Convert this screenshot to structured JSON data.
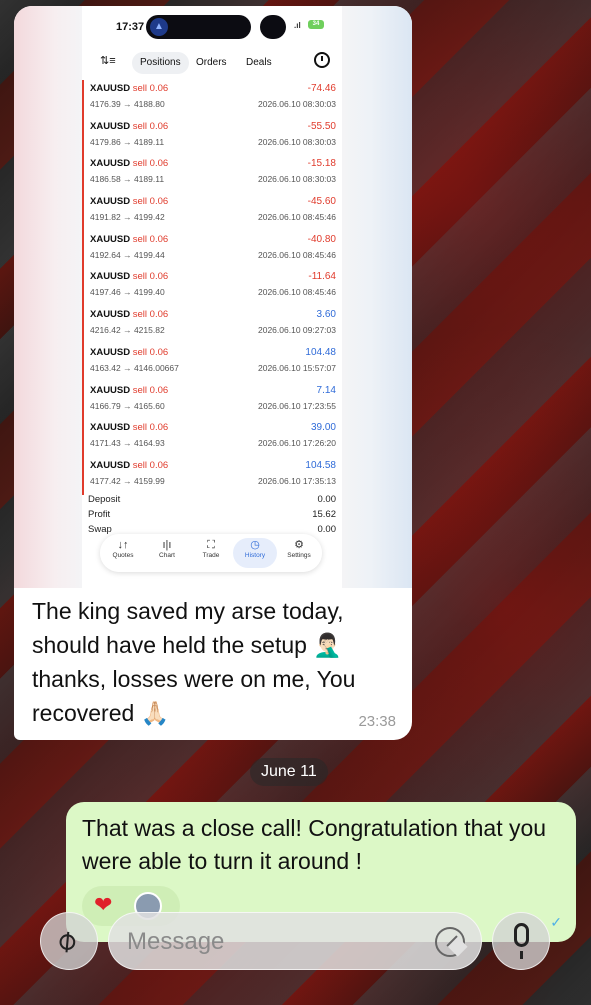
{
  "screenshot": {
    "status_time": "17:37",
    "nav_arrow": "navigation-arrow-icon",
    "battery": "34",
    "tabs": [
      {
        "label": "Positions",
        "active": true
      },
      {
        "label": "Orders",
        "active": false
      },
      {
        "label": "Deals",
        "active": false
      }
    ],
    "trades": [
      {
        "symbol": "XAUUSD",
        "dir": "sell 0.06",
        "prices": "4176.39 → 4188.80",
        "pl": "-74.46",
        "time": "2026.06.10 08:30:03",
        "sign": "neg"
      },
      {
        "symbol": "XAUUSD",
        "dir": "sell 0.06",
        "prices": "4179.86 → 4189.11",
        "pl": "-55.50",
        "time": "2026.06.10 08:30:03",
        "sign": "neg"
      },
      {
        "symbol": "XAUUSD",
        "dir": "sell 0.06",
        "prices": "4186.58 → 4189.11",
        "pl": "-15.18",
        "time": "2026.06.10 08:30:03",
        "sign": "neg"
      },
      {
        "symbol": "XAUUSD",
        "dir": "sell 0.06",
        "prices": "4191.82 → 4199.42",
        "pl": "-45.60",
        "time": "2026.06.10 08:45:46",
        "sign": "neg"
      },
      {
        "symbol": "XAUUSD",
        "dir": "sell 0.06",
        "prices": "4192.64 → 4199.44",
        "pl": "-40.80",
        "time": "2026.06.10 08:45:46",
        "sign": "neg"
      },
      {
        "symbol": "XAUUSD",
        "dir": "sell 0.06",
        "prices": "4197.46 → 4199.40",
        "pl": "-11.64",
        "time": "2026.06.10 08:45:46",
        "sign": "neg"
      },
      {
        "symbol": "XAUUSD",
        "dir": "sell 0.06",
        "prices": "4216.42 → 4215.82",
        "pl": "3.60",
        "time": "2026.06.10 09:27:03",
        "sign": "pos"
      },
      {
        "symbol": "XAUUSD",
        "dir": "sell 0.06",
        "prices": "4163.42 → 4146.00667",
        "pl": "104.48",
        "time": "2026.06.10 15:57:07",
        "sign": "pos"
      },
      {
        "symbol": "XAUUSD",
        "dir": "sell 0.06",
        "prices": "4166.79 → 4165.60",
        "pl": "7.14",
        "time": "2026.06.10 17:23:55",
        "sign": "pos"
      },
      {
        "symbol": "XAUUSD",
        "dir": "sell 0.06",
        "prices": "4171.43 → 4164.93",
        "pl": "39.00",
        "time": "2026.06.10 17:26:20",
        "sign": "pos"
      },
      {
        "symbol": "XAUUSD",
        "dir": "sell 0.06",
        "prices": "4177.42 → 4159.99",
        "pl": "104.58",
        "time": "2026.06.10 17:35:13",
        "sign": "pos"
      }
    ],
    "summary": [
      {
        "k": "Deposit",
        "v": "0.00"
      },
      {
        "k": "Profit",
        "v": "15.62"
      },
      {
        "k": "Swap",
        "v": "0.00"
      }
    ],
    "bottom_nav": [
      {
        "label": "Quotes",
        "icon": "↓↑"
      },
      {
        "label": "Chart",
        "icon": "ı|ı"
      },
      {
        "label": "Trade",
        "icon": "⛶"
      },
      {
        "label": "History",
        "icon": "◷"
      },
      {
        "label": "Settings",
        "icon": "⚙"
      }
    ]
  },
  "incoming": {
    "text": "The king saved my arse today, should have held the setup 🤦🏻‍♂️ thanks, losses were on me, You recovered 🙏🏻",
    "time": "23:38"
  },
  "date_separator": "June 11",
  "outgoing": {
    "text": "That was a close call! Congratulation that you were able to turn it around !",
    "reaction": "❤"
  },
  "composer": {
    "placeholder": "Message"
  },
  "colors": {
    "loss": "#e03b2c",
    "profit": "#2f6bd8",
    "outgoing_bubble": "#dcf8c6"
  }
}
